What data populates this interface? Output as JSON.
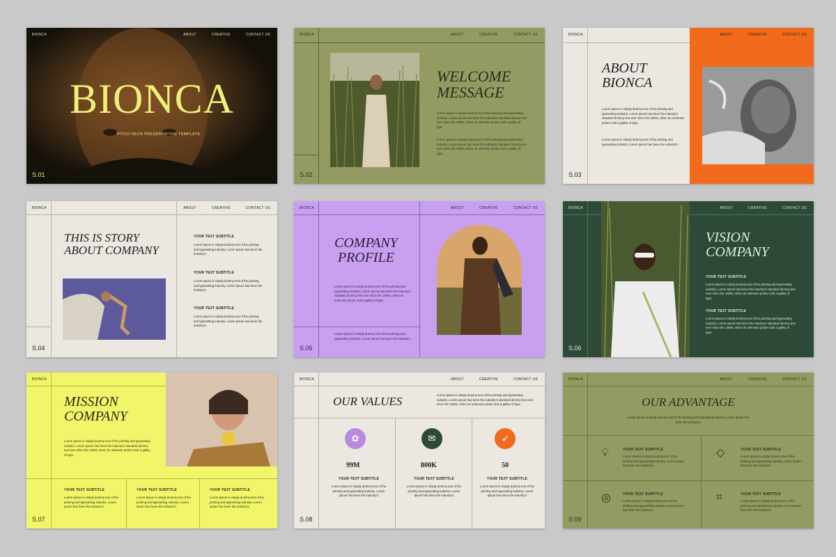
{
  "nav": {
    "brand": "BIONCA",
    "about": "ABOUT",
    "creative": "CREATIVE",
    "contact": "CONTACT US"
  },
  "lorem": "Lorem Ipsum is simply dummy text of the printing and typesetting industry. Lorem Ipsum has been the industry's standard dummy text ever since the 1500s, when an unknown printer took a galley of type.",
  "lorem_short": "Lorem Ipsum is simply dummy text of the printing and typesetting industry. Lorem Ipsum has been the industry's",
  "subtitle": "YOUR TEXT SUBTITLE",
  "s1": {
    "title": "BIONCA",
    "tagline": "PITCH DECK PRESENTATION TEMPLATE",
    "num": "S.01"
  },
  "s2": {
    "title1": "WELCOME",
    "title2": "MESSAGE",
    "num": "S.02"
  },
  "s3": {
    "title1": "ABOUT",
    "title2": "BIONCA",
    "num": "S.03"
  },
  "s4": {
    "title1": "THIS IS STORY",
    "title2": "ABOUT COMPANY",
    "num": "S.04"
  },
  "s5": {
    "title1": "COMPANY",
    "title2": "PROFILE",
    "num": "S.05"
  },
  "s6": {
    "title1": "VISION",
    "title2": "COMPANY",
    "num": "S.06"
  },
  "s7": {
    "title1": "MISSION",
    "title2": "COMPANY",
    "num": "S.07"
  },
  "s8": {
    "title": "OUR VALUES",
    "num": "S.08",
    "stats": [
      "99M",
      "800K",
      "50"
    ]
  },
  "s9": {
    "title": "OUR ADVANTAGE",
    "num": "S.09"
  },
  "colors": {
    "olive": "#949b62",
    "cream": "#ece7e0",
    "orange": "#f26a1b",
    "lilac": "#c99ff0",
    "forest": "#2d4a38",
    "yellow": "#f0f56a",
    "dark": "#1b1710"
  }
}
